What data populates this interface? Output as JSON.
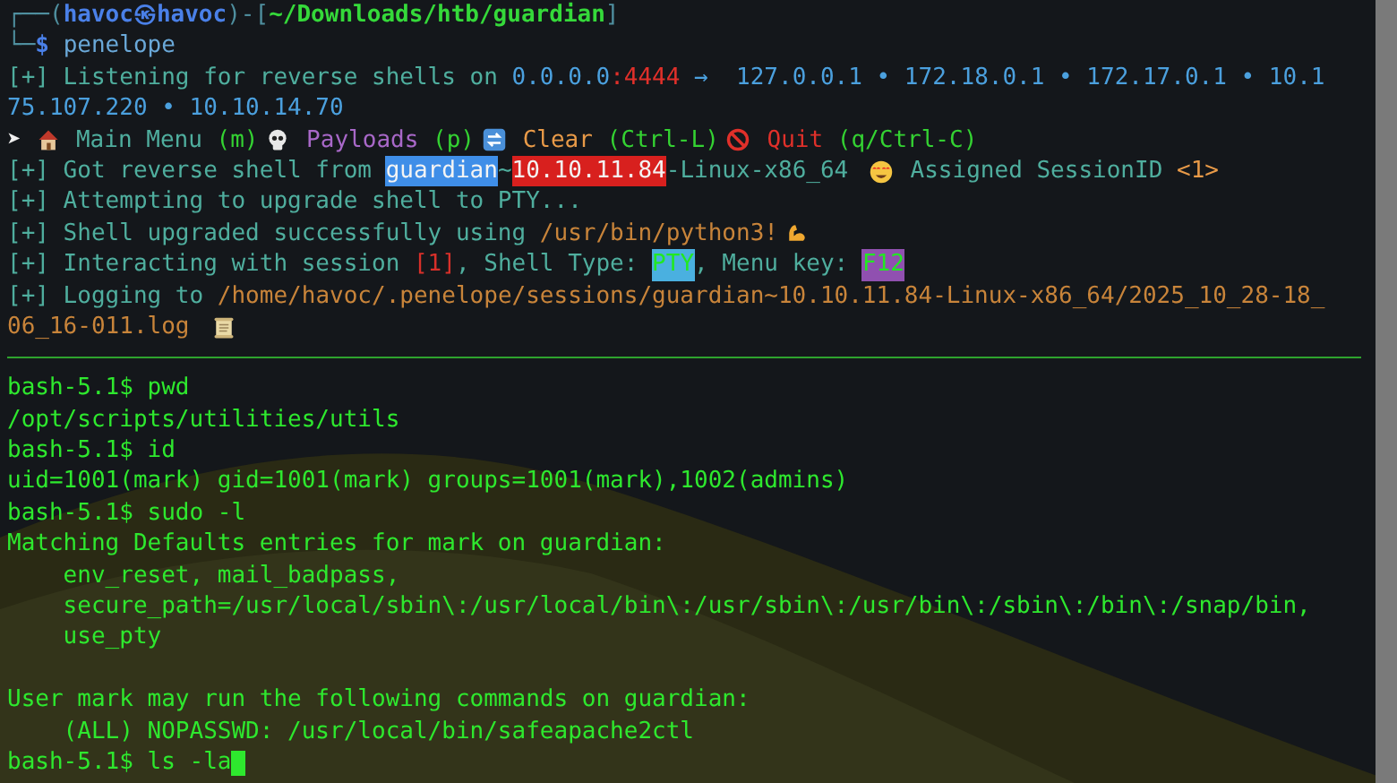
{
  "terminal": {
    "header_lines": [
      [
        {
          "kind": "frame",
          "text": "┌──("
        },
        {
          "kind": "user",
          "text": "havoc㉿havoc"
        },
        {
          "kind": "frame",
          "text": ")-["
        },
        {
          "kind": "cwd",
          "text": "~/Downloads/htb/guardian"
        },
        {
          "kind": "frame",
          "text": "]"
        }
      ],
      [
        {
          "kind": "frame",
          "text": "└─"
        },
        {
          "kind": "user",
          "text": "$ "
        },
        {
          "kind": "cmd",
          "text": "penelope"
        }
      ],
      [
        {
          "kind": "info",
          "text": "[+] Listening for reverse shells on "
        },
        {
          "kind": "ip",
          "text": "0.0.0.0"
        },
        {
          "kind": "port",
          "text": ":4444"
        },
        {
          "kind": "ip",
          "text": " →  127.0.0.1 • 172.18.0.1 • 172.17.0.1 • 10.1"
        }
      ],
      [
        {
          "kind": "ip",
          "text": "75.107.220 • 10.10.14.70"
        }
      ],
      [
        {
          "kind": "arrow",
          "text": "➤ "
        },
        {
          "kind": "house"
        },
        {
          "kind": "info",
          "text": " Main Menu "
        },
        {
          "kind": "key",
          "text": "(m)"
        },
        {
          "kind": "skull"
        },
        {
          "kind": "payload",
          "text": " Payloads "
        },
        {
          "kind": "key",
          "text": "(p)"
        },
        {
          "kind": "refresh"
        },
        {
          "kind": "clear",
          "text": " Clear "
        },
        {
          "kind": "key",
          "text": "(Ctrl-L)"
        },
        {
          "kind": "prohibited"
        },
        {
          "kind": "quit",
          "text": " Quit "
        },
        {
          "kind": "key",
          "text": "(q/Ctrl-C)"
        }
      ],
      [
        {
          "kind": "info",
          "text": "[+] Got reverse shell from "
        },
        {
          "kind": "host",
          "text": "guardian"
        },
        {
          "kind": "info",
          "text": "~"
        },
        {
          "kind": "addr",
          "text": "10.10.11.84"
        },
        {
          "kind": "info",
          "text": "-Linux-x86_64 "
        },
        {
          "kind": "hearteyes"
        },
        {
          "kind": "info",
          "text": " Assigned SessionID "
        },
        {
          "kind": "clear",
          "text": "<1>"
        }
      ],
      [
        {
          "kind": "info",
          "text": "[+] Attempting to upgrade shell to PTY..."
        }
      ],
      [
        {
          "kind": "info",
          "text": "[+] Shell upgraded successfully using "
        },
        {
          "kind": "path",
          "text": "/usr/bin/python3!"
        },
        {
          "kind": "muscle"
        }
      ],
      [
        {
          "kind": "info",
          "text": "[+] Interacting with session "
        },
        {
          "kind": "session",
          "text": "[1]"
        },
        {
          "kind": "info",
          "text": ", Shell Type: "
        },
        {
          "kind": "shelltype",
          "text": "PTY"
        },
        {
          "kind": "info",
          "text": ", Menu key: "
        },
        {
          "kind": "menukey",
          "text": "F12"
        }
      ],
      [
        {
          "kind": "info",
          "text": "[+] Logging to "
        },
        {
          "kind": "path",
          "text": "/home/havoc/.penelope/sessions/guardian~10.10.11.84-Linux-x86_64/2025_10_28-18_"
        }
      ],
      [
        {
          "kind": "path",
          "text": "06_16-011.log "
        },
        {
          "kind": "scroll"
        }
      ]
    ],
    "shell_blocks": [
      [
        "bash-5.1$ pwd",
        "/opt/scripts/utilities/utils",
        "bash-5.1$ id",
        "uid=1001(mark) gid=1001(mark) groups=1001(mark),1002(admins)",
        "bash-5.1$ sudo -l",
        "Matching Defaults entries for mark on guardian:",
        "    env_reset, mail_badpass,",
        "    secure_path=/usr/local/sbin\\:/usr/local/bin\\:/usr/sbin\\:/usr/bin\\:/sbin\\:/bin\\:/snap/bin,",
        "    use_pty"
      ],
      [
        "User mark may run the following commands on guardian:",
        "    (ALL) NOPASSWD: /usr/local/bin/safeapache2ctl",
        "bash-5.1$ ls -la"
      ]
    ]
  }
}
